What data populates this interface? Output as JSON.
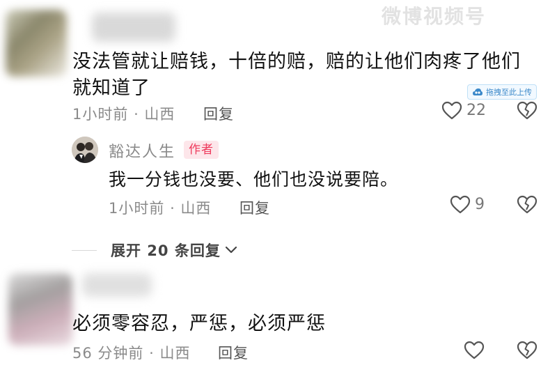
{
  "watermark": {
    "text": "微博视频号"
  },
  "upload_badge": {
    "label": "拖拽至此上传"
  },
  "comment1": {
    "text_line1": "没法管就让赔钱，十倍的赔，赔的让他们肉疼了他们",
    "text_line2": "就知道了",
    "time": "1小时前",
    "location": "山西",
    "reply_label": "回复",
    "like_count": "22"
  },
  "author_reply": {
    "name": "豁达人生",
    "tag": "作者",
    "text": "我一分钱也没要、他们也没说要陪。",
    "time": "1小时前",
    "location": "山西",
    "reply_label": "回复",
    "like_count": "9"
  },
  "expand_replies": {
    "label": "展开 20 条回复"
  },
  "comment2": {
    "text": "必须零容忍，严惩，必须严惩",
    "time": "56 分钟前",
    "location": "山西",
    "reply_label": "回复"
  },
  "colors": {
    "author_tag_bg": "#fde6ea",
    "author_tag_text": "#ee3a5c",
    "meta_gray": "#8a8a8a"
  },
  "icons": [
    "heart-icon",
    "broken-heart-icon",
    "chevron-down-icon",
    "cloud-upload-icon"
  ]
}
